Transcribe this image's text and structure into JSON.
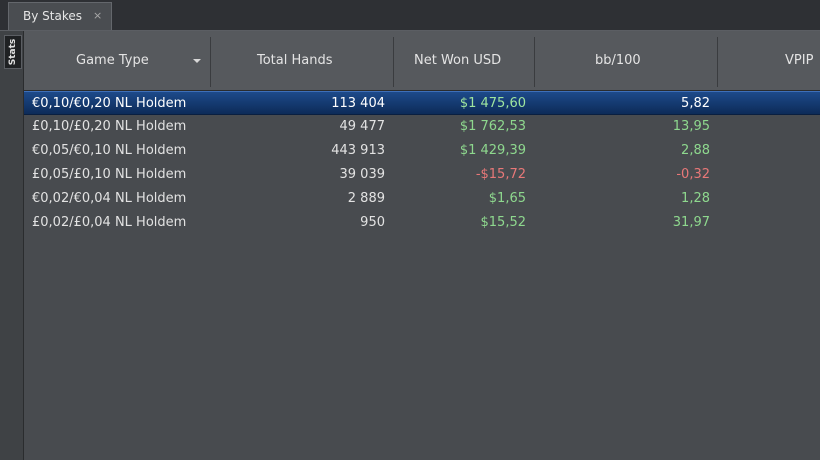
{
  "tab": {
    "label": "By Stakes",
    "close_glyph": "×"
  },
  "side_panel": {
    "label": "Stats"
  },
  "columns": [
    {
      "key": "game_type",
      "label": "Game Type"
    },
    {
      "key": "total_hands",
      "label": "Total Hands"
    },
    {
      "key": "net_won",
      "label": "Net Won USD"
    },
    {
      "key": "bb100",
      "label": "bb/100"
    },
    {
      "key": "vpip",
      "label": "VPIP"
    }
  ],
  "rows": [
    {
      "game_type": "€0,10/€0,20 NL Holdem",
      "total_hands": "113 404",
      "net_won": "$1 475,60",
      "bb100": "5,82",
      "selected": true
    },
    {
      "game_type": "£0,10/£0,20 NL Holdem",
      "total_hands": "49 477",
      "net_won": "$1 762,53",
      "bb100": "13,95"
    },
    {
      "game_type": "€0,05/€0,10 NL Holdem",
      "total_hands": "443 913",
      "net_won": "$1 429,39",
      "bb100": "2,88"
    },
    {
      "game_type": "£0,05/£0,10 NL Holdem",
      "total_hands": "39 039",
      "net_won": "-$15,72",
      "bb100": "-0,32"
    },
    {
      "game_type": "€0,02/€0,04 NL Holdem",
      "total_hands": "2 889",
      "net_won": "$1,65",
      "bb100": "1,28"
    },
    {
      "game_type": "£0,02/£0,04 NL Holdem",
      "total_hands": "950",
      "net_won": "$15,52",
      "bb100": "31,97"
    }
  ],
  "colors": {
    "positive": "#8ed88e",
    "negative": "#e87878",
    "selection": "#1d4a8a"
  }
}
